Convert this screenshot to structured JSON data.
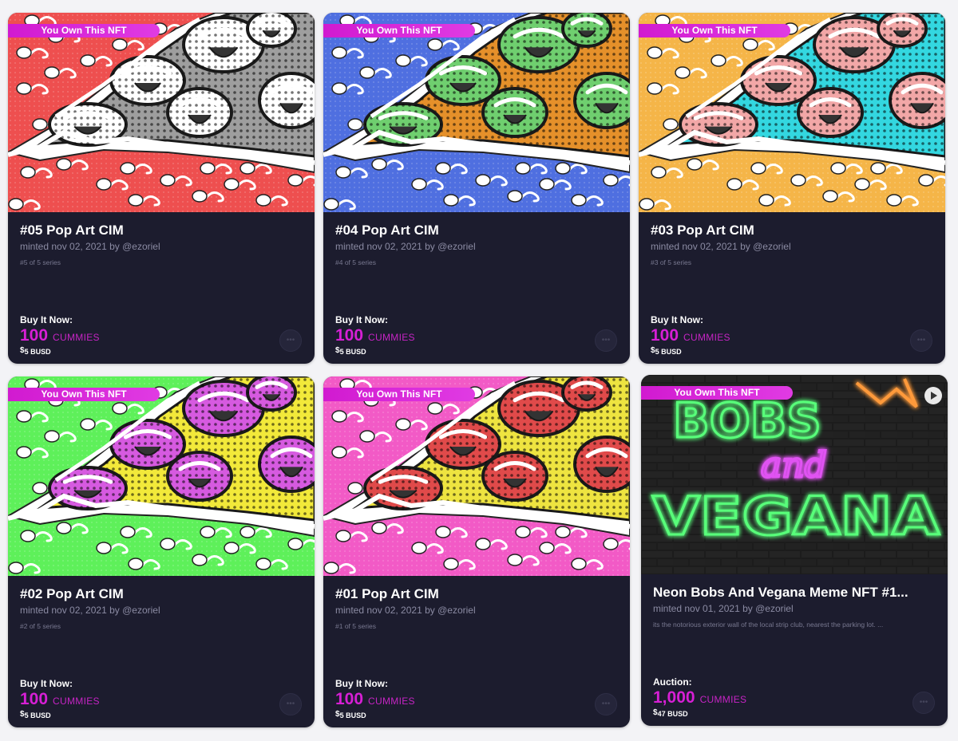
{
  "badge_text": "You Own This NFT",
  "cards": [
    {
      "title": "#05 Pop Art CIM",
      "minted": "minted nov 02, 2021 by @ezoriel",
      "subtitle": "#5 of 5 series",
      "sale_label": "Buy It Now:",
      "price": "100",
      "currency": "CUMMIES",
      "fiat_value": "5",
      "fiat_currency": "BUSD",
      "more_icon": "ellipsis-icon",
      "colors": {
        "bg": "#ee4f4f",
        "mouth": "#ffffff",
        "center": "#9e9e9e"
      }
    },
    {
      "title": "#04 Pop Art CIM",
      "minted": "minted nov 02, 2021 by @ezoriel",
      "subtitle": "#4 of 5 series",
      "sale_label": "Buy It Now:",
      "price": "100",
      "currency": "CUMMIES",
      "fiat_value": "5",
      "fiat_currency": "BUSD",
      "more_icon": "ellipsis-icon",
      "colors": {
        "bg": "#4f6fe0",
        "mouth": "#6fcf6f",
        "center": "#e5902a"
      }
    },
    {
      "title": "#03 Pop Art CIM",
      "minted": "minted nov 02, 2021 by @ezoriel",
      "subtitle": "#3 of 5 series",
      "sale_label": "Buy It Now:",
      "price": "100",
      "currency": "CUMMIES",
      "fiat_value": "5",
      "fiat_currency": "BUSD",
      "more_icon": "ellipsis-icon",
      "colors": {
        "bg": "#f5b548",
        "mouth": "#f2a7a7",
        "center": "#33d7e0"
      }
    },
    {
      "title": "#02 Pop Art CIM",
      "minted": "minted nov 02, 2021 by @ezoriel",
      "subtitle": "#2 of 5 series",
      "sale_label": "Buy It Now:",
      "price": "100",
      "currency": "CUMMIES",
      "fiat_value": "5",
      "fiat_currency": "BUSD",
      "more_icon": "ellipsis-icon",
      "colors": {
        "bg": "#5ef05a",
        "mouth": "#d65ae0",
        "center": "#f2e93a"
      }
    },
    {
      "title": "#01 Pop Art CIM",
      "minted": "minted nov 02, 2021 by @ezoriel",
      "subtitle": "#1 of 5 series",
      "sale_label": "Buy It Now:",
      "price": "100",
      "currency": "CUMMIES",
      "fiat_value": "5",
      "fiat_currency": "BUSD",
      "more_icon": "ellipsis-icon",
      "colors": {
        "bg": "#f25ac6",
        "mouth": "#e04a4a",
        "center": "#eee440"
      }
    },
    {
      "title": "Neon Bobs And Vegana Meme NFT #1...",
      "minted": "minted nov 01, 2021 by @ezoriel",
      "subtitle": "its the notorious exterior wall of the local strip club, nearest the parking lot. ...",
      "sale_label": "Auction:",
      "price": "1,000",
      "currency": "CUMMIES",
      "fiat_value": "47",
      "fiat_currency": "BUSD",
      "more_icon": "ellipsis-icon",
      "art_text": {
        "line1": "BOBS",
        "line2": "and",
        "line3": "VEGANA"
      },
      "play_icon": "play-icon",
      "colors": {
        "neon_green": "#58ff7a",
        "neon_pink": "#e052f2",
        "neon_orange": "#ff9a3a",
        "wall": "#2a2a2a"
      }
    }
  ]
}
